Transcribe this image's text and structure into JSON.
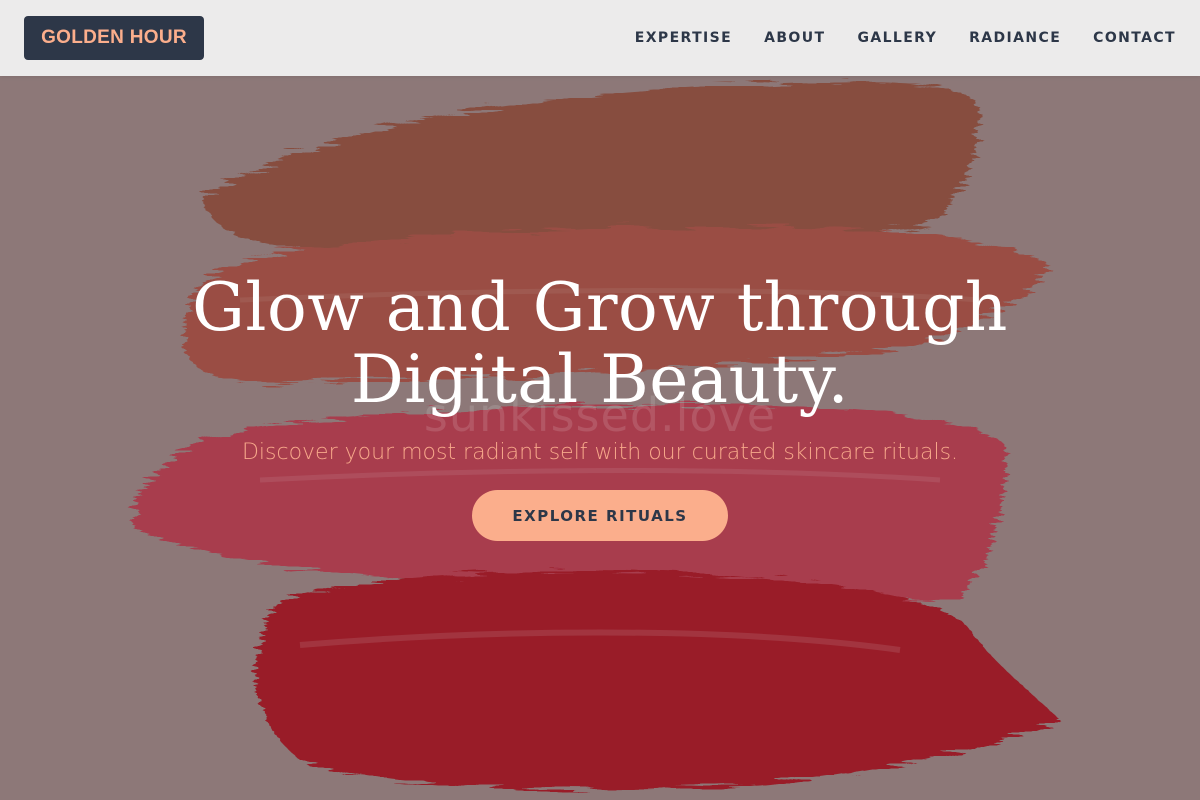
{
  "brand": {
    "logo_text": "GOLDEN HOUR"
  },
  "nav": {
    "items": [
      {
        "label": "EXPERTISE"
      },
      {
        "label": "ABOUT"
      },
      {
        "label": "GALLERY"
      },
      {
        "label": "RADIANCE"
      },
      {
        "label": "CONTACT"
      }
    ]
  },
  "hero": {
    "headline_line1": "Glow and Grow through",
    "headline_line2": "Digital Beauty.",
    "watermark": "sunkissed.love",
    "subtitle": "Discover your most radiant self with our curated skincare rituals.",
    "cta_label": "EXPLORE RITUALS",
    "image_description": "lipstick-swatches-background"
  },
  "colors": {
    "accent": "#fbae8c",
    "logo_bg": "#2d3748",
    "nav_text": "#2d3748",
    "headline": "#ffffff",
    "subtitle": "#f7a88a",
    "swatch_brown": "#8a4a38",
    "swatch_terracotta": "#a14a3e",
    "swatch_crimson": "#b3364a",
    "swatch_red": "#a0101c",
    "backdrop": "#927d7d"
  }
}
